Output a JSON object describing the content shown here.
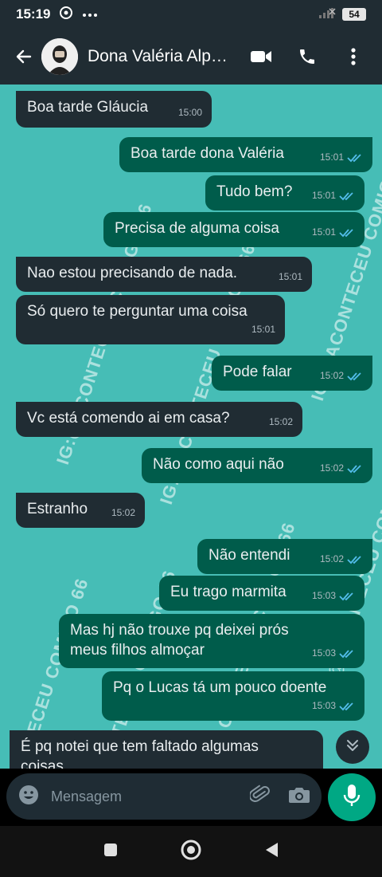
{
  "status": {
    "time": "15:19",
    "battery": "54"
  },
  "header": {
    "contact_name": "Dona Valéria Alp…"
  },
  "watermark_text": "IG:@ACONTECEU COMIGO 66",
  "messages": [
    {
      "dir": "in",
      "text": "Boa tarde Gláucia",
      "time": "15:00"
    },
    {
      "dir": "out",
      "text": "Boa tarde dona Valéria",
      "time": "15:01"
    },
    {
      "dir": "out",
      "text": "Tudo bem?",
      "time": "15:01"
    },
    {
      "dir": "out",
      "text": "Precisa de alguma coisa",
      "time": "15:01"
    },
    {
      "dir": "in",
      "text": "Nao estou precisando de nada.",
      "time": "15:01"
    },
    {
      "dir": "in",
      "text": "Só quero te perguntar uma coisa",
      "time": "15:01"
    },
    {
      "dir": "out",
      "text": "Pode falar",
      "time": "15:02"
    },
    {
      "dir": "in",
      "text": "Vc está comendo ai em casa?",
      "time": "15:02"
    },
    {
      "dir": "out",
      "text": "Não como aqui não",
      "time": "15:02"
    },
    {
      "dir": "in",
      "text": "Estranho",
      "time": "15:02"
    },
    {
      "dir": "out",
      "text": "Não entendi",
      "time": "15:02"
    },
    {
      "dir": "out",
      "text": "Eu trago marmita",
      "time": "15:03"
    },
    {
      "dir": "out",
      "text": "Mas hj não trouxe pq deixei prós meus filhos almoçar",
      "time": "15:03"
    },
    {
      "dir": "out",
      "text": "Pq o Lucas tá um pouco doente",
      "time": "15:03"
    },
    {
      "dir": "in",
      "text": "É pq notei que tem faltado algumas coisas",
      "time": ""
    }
  ],
  "composer": {
    "placeholder": "Mensagem"
  },
  "colors": {
    "chat_bg": "#46bdb6",
    "incoming": "#202c33",
    "outgoing": "#005c4b",
    "read_ticks": "#53bdeb",
    "mic": "#00a884"
  }
}
